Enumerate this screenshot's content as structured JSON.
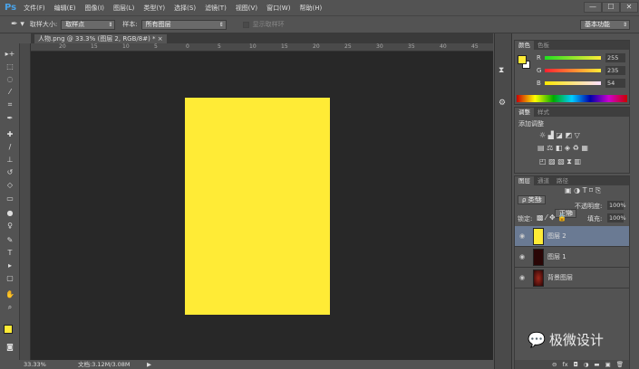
{
  "app": {
    "logo": "Ps",
    "menus": [
      "文件(F)",
      "编辑(E)",
      "图像(I)",
      "图层(L)",
      "类型(Y)",
      "选择(S)",
      "滤镜(T)",
      "视图(V)",
      "窗口(W)",
      "帮助(H)"
    ],
    "window_buttons": [
      "—",
      "☐",
      "✕"
    ]
  },
  "options": {
    "sample_size_label": "取样大小:",
    "sample_size_value": "取样点",
    "sample_label": "样本:",
    "sample_value": "所有图层",
    "show_ring_label": "显示取样环",
    "workspace": "基本功能"
  },
  "document": {
    "tab_title": "人物.png @ 33.3% (图层 2, RGB/8#) *",
    "close": "×",
    "fill_color": "#ffeb36"
  },
  "ruler": {
    "labels": [
      "20",
      "15",
      "10",
      "5",
      "0",
      "5",
      "10",
      "15",
      "20",
      "25",
      "30",
      "35",
      "40",
      "45"
    ]
  },
  "status": {
    "zoom": "33.33%",
    "doc_info": "文档:3.12M/3.08M",
    "arrow": "▶"
  },
  "color_panel": {
    "tabs": [
      "颜色",
      "色板"
    ],
    "channels": [
      {
        "label": "R",
        "value": "255"
      },
      {
        "label": "G",
        "value": "235"
      },
      {
        "label": "B",
        "value": "54"
      }
    ],
    "foreground": "#ffeb36",
    "background": "#ffffff"
  },
  "adjust_panel": {
    "tabs": [
      "调整",
      "样式"
    ],
    "title": "添加调整"
  },
  "layers_panel": {
    "tabs": [
      "图层",
      "通道",
      "路径"
    ],
    "filter": "ρ 类型",
    "blend": "正常",
    "opacity_label": "不透明度:",
    "opacity": "100%",
    "lock_label": "锁定:",
    "fill_label": "填充:",
    "fill": "100%",
    "layers": [
      {
        "name": "图层 2",
        "selected": true,
        "thumb": "#ffeb36"
      },
      {
        "name": "图层 1",
        "selected": false,
        "thumb": "#2a0606"
      },
      {
        "name": "背景图层",
        "selected": false,
        "thumb": "#3a0a08"
      }
    ],
    "footer_icons": [
      "link-icon",
      "fx-icon",
      "mask-icon",
      "adjustment-icon",
      "folder-icon",
      "new-layer-icon",
      "trash-icon"
    ],
    "footer_glyphs": [
      "⊖",
      "fx",
      "◘",
      "◑",
      "▬",
      "▣",
      "🗑"
    ]
  },
  "watermark": "极微设计"
}
